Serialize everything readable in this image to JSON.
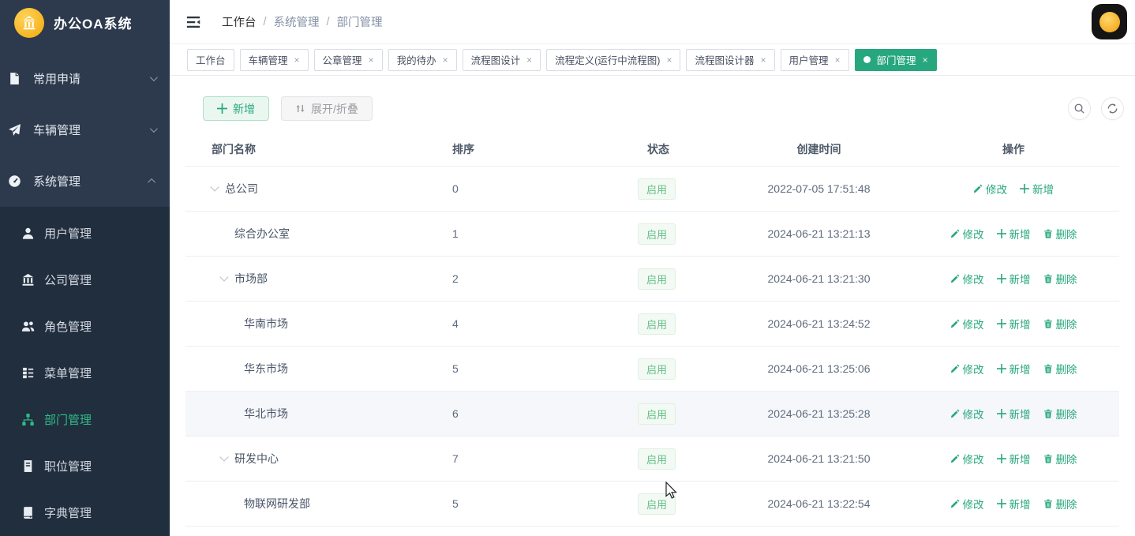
{
  "app": {
    "title": "办公OA系统"
  },
  "sidebar": {
    "menu": [
      {
        "id": "common-apply",
        "label": "常用申请",
        "icon": "document-icon",
        "chevron": "down"
      },
      {
        "id": "vehicle-mgmt",
        "label": "车辆管理",
        "icon": "send-icon",
        "chevron": "down"
      },
      {
        "id": "system-mgmt",
        "label": "系统管理",
        "icon": "dashboard-icon",
        "chevron": "up"
      }
    ],
    "submenu": [
      {
        "id": "user-mgmt",
        "label": "用户管理",
        "icon": "user-icon",
        "active": false
      },
      {
        "id": "company-mgmt",
        "label": "公司管理",
        "icon": "bank-icon",
        "active": false
      },
      {
        "id": "role-mgmt",
        "label": "角色管理",
        "icon": "team-icon",
        "active": false
      },
      {
        "id": "menu-mgmt",
        "label": "菜单管理",
        "icon": "menu-tree-icon",
        "active": false
      },
      {
        "id": "department-mgmt",
        "label": "部门管理",
        "icon": "org-chart-icon",
        "active": true
      },
      {
        "id": "position-mgmt",
        "label": "职位管理",
        "icon": "id-card-icon",
        "active": false
      },
      {
        "id": "dictionary-mgmt",
        "label": "字典管理",
        "icon": "book-icon",
        "active": false
      }
    ]
  },
  "topbar": {
    "separator": "/",
    "breadcrumb": [
      {
        "label": "工作台",
        "muted": false
      },
      {
        "label": "系统管理",
        "muted": true
      },
      {
        "label": "部门管理",
        "muted": true
      }
    ]
  },
  "tabs": [
    {
      "id": "workbench",
      "label": "工作台",
      "closable": false,
      "active": false
    },
    {
      "id": "vehicle",
      "label": "车辆管理",
      "closable": true,
      "active": false
    },
    {
      "id": "seal",
      "label": "公章管理",
      "closable": true,
      "active": false
    },
    {
      "id": "my-todo",
      "label": "我的待办",
      "closable": true,
      "active": false
    },
    {
      "id": "flow-design",
      "label": "流程图设计",
      "closable": true,
      "active": false
    },
    {
      "id": "flow-definition",
      "label": "流程定义(运行中流程图)",
      "closable": true,
      "active": false
    },
    {
      "id": "flow-designer",
      "label": "流程图设计器",
      "closable": true,
      "active": false
    },
    {
      "id": "user",
      "label": "用户管理",
      "closable": true,
      "active": false
    },
    {
      "id": "department",
      "label": "部门管理",
      "closable": true,
      "active": true
    }
  ],
  "toolbar": {
    "add": "新增",
    "toggle": "展开/折叠"
  },
  "table": {
    "columns": [
      "部门名称",
      "排序",
      "状态",
      "创建时间",
      "操作"
    ],
    "ops": {
      "edit": "修改",
      "add": "新增",
      "remove": "删除"
    },
    "rows": [
      {
        "name": "总公司",
        "level": 0,
        "expandable": true,
        "sort": "0",
        "status": "启用",
        "created": "2022-07-05 17:51:48",
        "deletable": false,
        "highlighted": false
      },
      {
        "name": "综合办公室",
        "level": 1,
        "expandable": false,
        "sort": "1",
        "status": "启用",
        "created": "2024-06-21 13:21:13",
        "deletable": true,
        "highlighted": false
      },
      {
        "name": "市场部",
        "level": 1,
        "expandable": true,
        "sort": "2",
        "status": "启用",
        "created": "2024-06-21 13:21:30",
        "deletable": true,
        "highlighted": false
      },
      {
        "name": "华南市场",
        "level": 2,
        "expandable": false,
        "sort": "4",
        "status": "启用",
        "created": "2024-06-21 13:24:52",
        "deletable": true,
        "highlighted": false
      },
      {
        "name": "华东市场",
        "level": 2,
        "expandable": false,
        "sort": "5",
        "status": "启用",
        "created": "2024-06-21 13:25:06",
        "deletable": true,
        "highlighted": false
      },
      {
        "name": "华北市场",
        "level": 2,
        "expandable": false,
        "sort": "6",
        "status": "启用",
        "created": "2024-06-21 13:25:28",
        "deletable": true,
        "highlighted": true
      },
      {
        "name": "研发中心",
        "level": 1,
        "expandable": true,
        "sort": "7",
        "status": "启用",
        "created": "2024-06-21 13:21:50",
        "deletable": true,
        "highlighted": false
      },
      {
        "name": "物联网研发部",
        "level": 2,
        "expandable": false,
        "sort": "5",
        "status": "启用",
        "created": "2024-06-21 13:22:54",
        "deletable": true,
        "highlighted": false
      }
    ]
  },
  "colors": {
    "accent": "#27a77d",
    "active_menu": "#2fbd88",
    "sidebar_bg": "#2d3a4d",
    "submenu_bg": "#212e3e",
    "badge_text": "#67c089",
    "badge_bg": "#f2faf3",
    "badge_border": "#dff0e2"
  }
}
